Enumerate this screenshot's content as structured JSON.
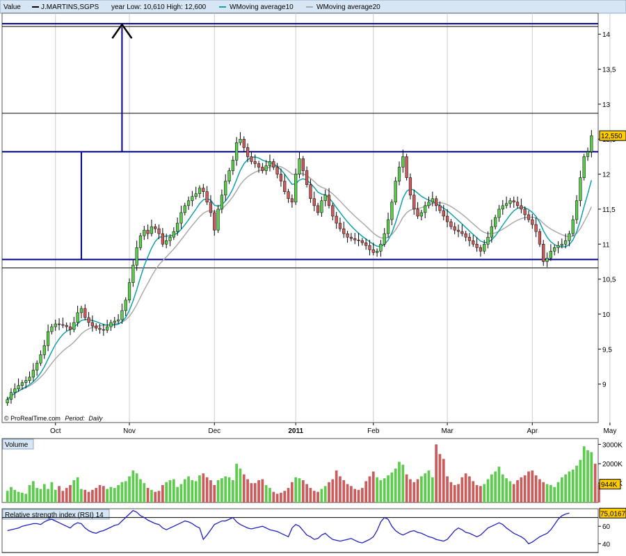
{
  "header": {
    "value_label": "Value",
    "instrument": "J.MARTINS,SGPS",
    "year_range": "year Low: 10,610 High: 12,600",
    "ma10_label": "WMoving average10",
    "ma20_label": "WMoving average20"
  },
  "footer": {
    "source": "© ProRealTime.com",
    "period_label": "Period:",
    "period_value": "Daily"
  },
  "colors": {
    "up": "#5ccc4c",
    "down": "#cc5c5c",
    "ma10": "#0fa0aa",
    "ma20": "#aaaaaa",
    "level": "#00008b",
    "rsi": "#1f1fbf",
    "panel_bg": "#d6e6f5"
  },
  "chart_data": {
    "type": "candlestick",
    "price_axis_ticks": [
      "9",
      "9,5",
      "10",
      "10,5",
      "11",
      "11,5",
      "12",
      "12,5",
      "13",
      "13,5",
      "14"
    ],
    "price_axis_values": [
      9,
      9.5,
      10,
      10.5,
      11,
      11.5,
      12,
      12.5,
      13,
      13.5,
      14
    ],
    "ylim": [
      8.45,
      14.3
    ],
    "last_price_label": "12,550",
    "last_price": 12.55,
    "months": [
      "Oct",
      "Nov",
      "Dec",
      "2011",
      "Feb",
      "Mar",
      "Apr",
      "May"
    ],
    "month_start_index": [
      13,
      33,
      56,
      78,
      99,
      119,
      142,
      163
    ],
    "horizontal_levels": [
      14.15,
      12.87,
      12.32,
      10.78,
      10.66
    ],
    "projection_start": 12.32,
    "projection_target": 14.1,
    "closes": [
      8.78,
      8.88,
      8.93,
      8.98,
      9.02,
      9.05,
      9.1,
      9.2,
      9.3,
      9.42,
      9.55,
      9.75,
      9.82,
      9.86,
      9.85,
      9.84,
      9.82,
      9.78,
      9.88,
      10.02,
      10.08,
      9.95,
      9.88,
      9.83,
      9.8,
      9.78,
      9.77,
      9.82,
      9.88,
      9.9,
      9.92,
      10.05,
      10.2,
      10.45,
      10.7,
      10.95,
      11.12,
      11.2,
      11.15,
      11.25,
      11.22,
      11.15,
      11.0,
      11.05,
      11.1,
      11.18,
      11.3,
      11.45,
      11.55,
      11.62,
      11.68,
      11.72,
      11.8,
      11.75,
      11.6,
      11.45,
      11.2,
      11.5,
      11.7,
      11.9,
      12.05,
      12.2,
      12.45,
      12.5,
      12.38,
      12.25,
      12.18,
      12.15,
      12.1,
      12.05,
      12.12,
      12.18,
      12.1,
      12.0,
      11.9,
      11.75,
      11.65,
      11.6,
      12.0,
      12.22,
      12.05,
      11.85,
      11.65,
      11.55,
      11.45,
      11.62,
      11.7,
      11.55,
      11.4,
      11.3,
      11.22,
      11.15,
      11.1,
      11.08,
      11.06,
      11.05,
      11.02,
      10.98,
      10.92,
      10.88,
      10.9,
      11.0,
      11.15,
      11.35,
      11.6,
      11.9,
      12.1,
      12.25,
      11.95,
      11.7,
      11.5,
      11.4,
      11.45,
      11.55,
      11.6,
      11.65,
      11.55,
      11.48,
      11.4,
      11.32,
      11.25,
      11.2,
      11.18,
      11.15,
      11.1,
      11.05,
      11.0,
      10.95,
      10.9,
      11.0,
      11.1,
      11.25,
      11.38,
      11.5,
      11.55,
      11.58,
      11.62,
      11.6,
      11.55,
      11.5,
      11.42,
      11.35,
      11.28,
      11.18,
      11.0,
      10.75,
      10.8,
      10.9,
      10.95,
      10.98,
      11.0,
      11.05,
      11.15,
      11.35,
      11.62,
      11.95,
      12.25,
      12.32,
      12.55
    ],
    "volume_axis_ticks": [
      "3000K",
      "2000K",
      "1000K"
    ],
    "volume_axis_values": [
      3000,
      2000,
      1000
    ],
    "volume_last_label": "944K",
    "volume_last": 944,
    "volume_title": "Volume",
    "volumes": [
      600,
      800,
      650,
      550,
      500,
      450,
      900,
      1100,
      750,
      700,
      950,
      700,
      1050,
      650,
      850,
      600,
      750,
      900,
      1150,
      1300,
      700,
      650,
      550,
      650,
      750,
      900,
      850,
      700,
      800,
      750,
      900,
      1050,
      1100,
      1350,
      1650,
      1500,
      1200,
      1000,
      750,
      650,
      550,
      600,
      900,
      1050,
      1150,
      1200,
      800,
      950,
      1200,
      1350,
      1150,
      1100,
      1400,
      1500,
      1300,
      1150,
      900,
      1150,
      1250,
      1350,
      1300,
      1150,
      2000,
      1750,
      1450,
      1200,
      1000,
      1000,
      1150,
      1200,
      900,
      750,
      550,
      450,
      500,
      600,
      750,
      1050,
      1300,
      1250,
      1150,
      950,
      750,
      600,
      550,
      700,
      850,
      1050,
      1200,
      1650,
      1350,
      1150,
      950,
      850,
      700,
      650,
      750,
      1100,
      1350,
      1600,
      1300,
      1150,
      1250,
      1400,
      1550,
      1750,
      2100,
      1950,
      1450,
      1200,
      1050,
      1200,
      1350,
      1500,
      1650,
      1300,
      3000,
      2500,
      2250,
      1350,
      1050,
      900,
      950,
      1300,
      1500,
      1350,
      1100,
      900,
      850,
      950,
      1200,
      1450,
      1600,
      1850,
      1450,
      1250,
      1100,
      950,
      1150,
      1300,
      1400,
      1600,
      1650,
      1400,
      1200,
      1050,
      950,
      900,
      800,
      1050,
      1300,
      1450,
      1600,
      1700,
      1900,
      2200,
      2900,
      2700,
      2600,
      2000,
      944
    ],
    "rsi_title": "Relative strength index (RSI) 14",
    "rsi_axis_ticks": [
      "60",
      "40"
    ],
    "rsi_axis_values": [
      60,
      40
    ],
    "rsi_last_label": "75,0167",
    "rsi_last": 75.0167,
    "rsi_levels": [
      70,
      30
    ],
    "rsi": [
      55,
      56,
      57,
      58,
      60,
      61,
      62,
      63,
      63,
      62,
      65,
      67,
      68,
      66,
      64,
      62,
      60,
      58,
      62,
      64,
      63,
      58,
      55,
      53,
      52,
      54,
      55,
      57,
      59,
      61,
      62,
      66,
      70,
      74,
      78,
      76,
      72,
      70,
      67,
      65,
      63,
      62,
      58,
      56,
      58,
      60,
      62,
      64,
      66,
      65,
      63,
      60,
      58,
      45,
      50,
      56,
      62,
      64,
      66,
      66,
      68,
      70,
      65,
      62,
      60,
      58,
      57,
      58,
      59,
      60,
      58,
      56,
      55,
      54,
      52,
      50,
      48,
      58,
      62,
      60,
      55,
      50,
      48,
      45,
      46,
      50,
      52,
      48,
      45,
      44,
      43,
      44,
      45,
      46,
      44,
      42,
      41,
      43,
      45,
      48,
      55,
      65,
      70,
      68,
      60,
      55,
      52,
      50,
      52,
      54,
      55,
      53,
      52,
      50,
      48,
      47,
      45,
      44,
      43,
      45,
      50,
      55,
      58,
      56,
      53,
      52,
      50,
      48,
      50,
      54,
      58,
      60,
      62,
      64,
      62,
      58,
      55,
      52,
      50,
      48,
      45,
      40,
      42,
      45,
      48,
      50,
      52,
      56,
      62,
      68,
      72,
      74,
      75.0167
    ]
  }
}
